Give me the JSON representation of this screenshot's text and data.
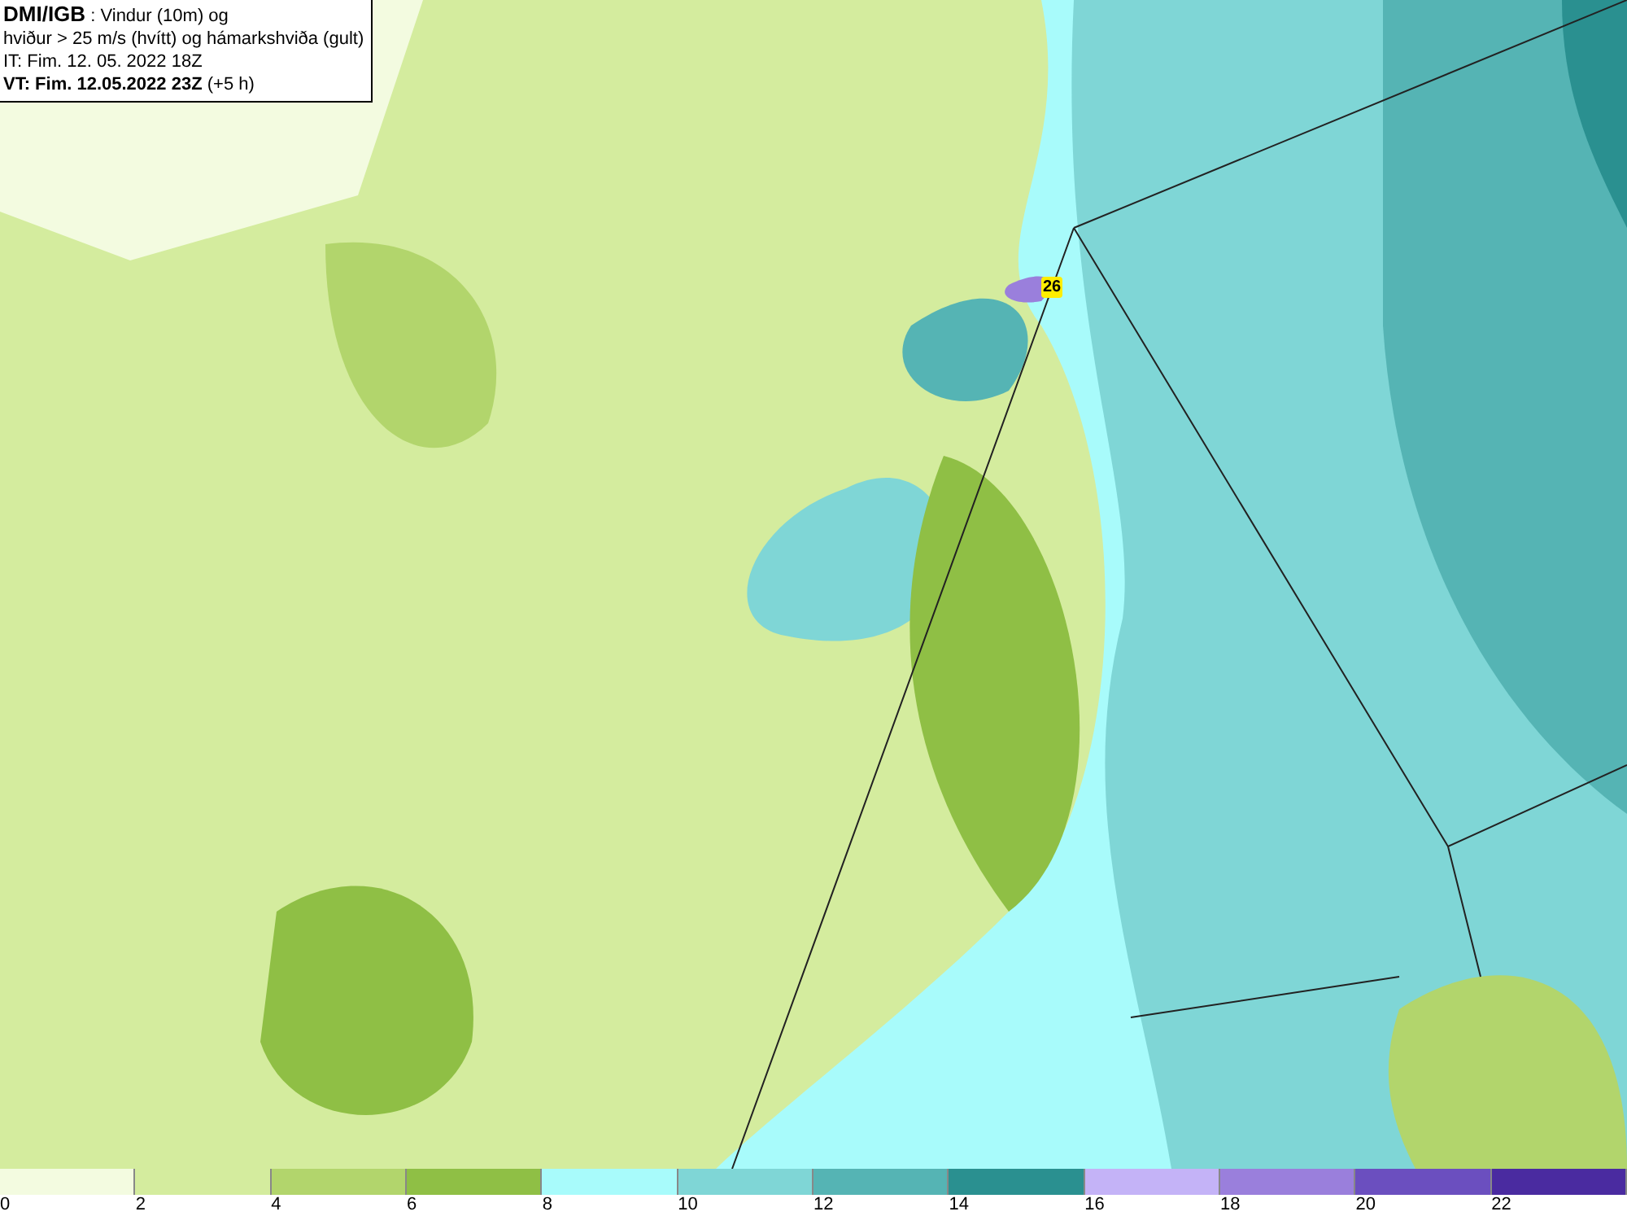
{
  "info": {
    "source": "DMI/IGB",
    "title_rest": " : Vindur (10m) og",
    "line2": "hviður > 25 m/s (hvítt) og hámarkshviða (gult)",
    "line3": "IT: Fim. 12. 05. 2022 18Z",
    "line4_bold": "VT: Fim. 12.05.2022 23Z",
    "line4_rest": " (+5 h)"
  },
  "map": {
    "gust_badge": "26"
  },
  "legend": [
    {
      "label": "0",
      "color": "#f3fbe0"
    },
    {
      "label": "2",
      "color": "#d4ec9e"
    },
    {
      "label": "4",
      "color": "#b2d56c"
    },
    {
      "label": "6",
      "color": "#8fbf45"
    },
    {
      "label": "8",
      "color": "#a8fbfb"
    },
    {
      "label": "10",
      "color": "#7fd6d6"
    },
    {
      "label": "12",
      "color": "#55b4b4"
    },
    {
      "label": "14",
      "color": "#2a9090"
    },
    {
      "label": "16",
      "color": "#c4b3f7"
    },
    {
      "label": "18",
      "color": "#9a7fdc"
    },
    {
      "label": "20",
      "color": "#6b4fbf"
    },
    {
      "label": "22",
      "color": "#4a2ba0"
    }
  ]
}
